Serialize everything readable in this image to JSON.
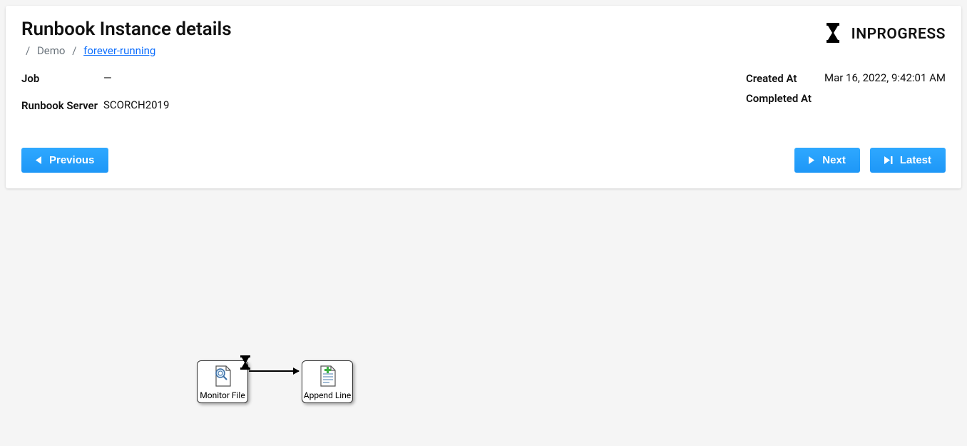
{
  "header": {
    "title": "Runbook Instance details",
    "breadcrumb": {
      "item1": "Demo",
      "item2": "forever-running"
    },
    "status": "INPROGRESS"
  },
  "details": {
    "job_label": "Job",
    "job_value": "—",
    "server_label": "Runbook Server",
    "server_value": "SCORCH2019",
    "created_label": "Created At",
    "created_value": "Mar 16, 2022, 9:42:01 AM",
    "completed_label": "Completed At",
    "completed_value": ""
  },
  "buttons": {
    "previous": "Previous",
    "next": "Next",
    "latest": "Latest"
  },
  "diagram": {
    "node1_label": "Monitor File",
    "node2_label": "Append Line"
  }
}
